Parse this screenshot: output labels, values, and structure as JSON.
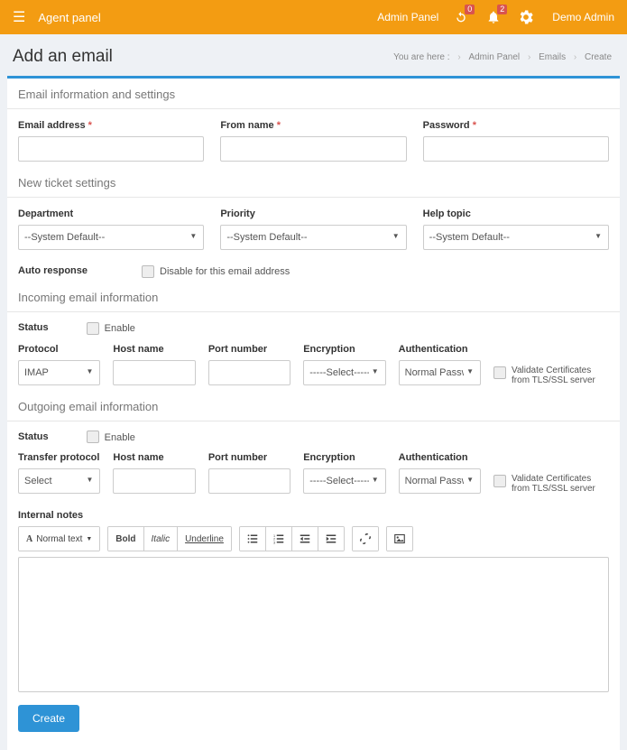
{
  "topbar": {
    "title": "Agent panel",
    "admin_link": "Admin Panel",
    "badge1": "0",
    "badge2": "2",
    "user": "Demo Admin"
  },
  "page": {
    "title": "Add an email",
    "crumb_here": "You are here :",
    "crumb1": "Admin Panel",
    "crumb2": "Emails",
    "crumb3": "Create"
  },
  "sec1": {
    "title": "Email information and settings",
    "email_label": "Email address",
    "from_label": "From name",
    "pass_label": "Password"
  },
  "sec2": {
    "title": "New ticket settings",
    "dept_label": "Department",
    "prio_label": "Priority",
    "help_label": "Help topic",
    "sysdefault": "--System Default--",
    "auto_label": "Auto response",
    "disable_label": "Disable for this email address"
  },
  "sec3": {
    "title": "Incoming email information",
    "status_label": "Status",
    "enable_label": "Enable",
    "protocol_label": "Protocol",
    "protocol_value": "IMAP",
    "host_label": "Host name",
    "port_label": "Port number",
    "enc_label": "Encryption",
    "enc_value": "-----Select-----",
    "auth_label": "Authentication",
    "auth_value": "Normal Password",
    "validate_label": "Validate Certificates from TLS/SSL server"
  },
  "sec4": {
    "title": "Outgoing email information",
    "status_label": "Status",
    "enable_label": "Enable",
    "tp_label": "Transfer protocol",
    "tp_value": "Select",
    "host_label": "Host name",
    "port_label": "Port number",
    "enc_label": "Encryption",
    "enc_value": "-----Select-----",
    "auth_label": "Authentication",
    "auth_value": "Normal Password",
    "validate_label": "Validate Certificates from TLS/SSL server"
  },
  "notes": {
    "label": "Internal notes",
    "normal_text": "Normal text",
    "bold": "Bold",
    "italic": "Italic",
    "underline": "Underline"
  },
  "submit": "Create"
}
